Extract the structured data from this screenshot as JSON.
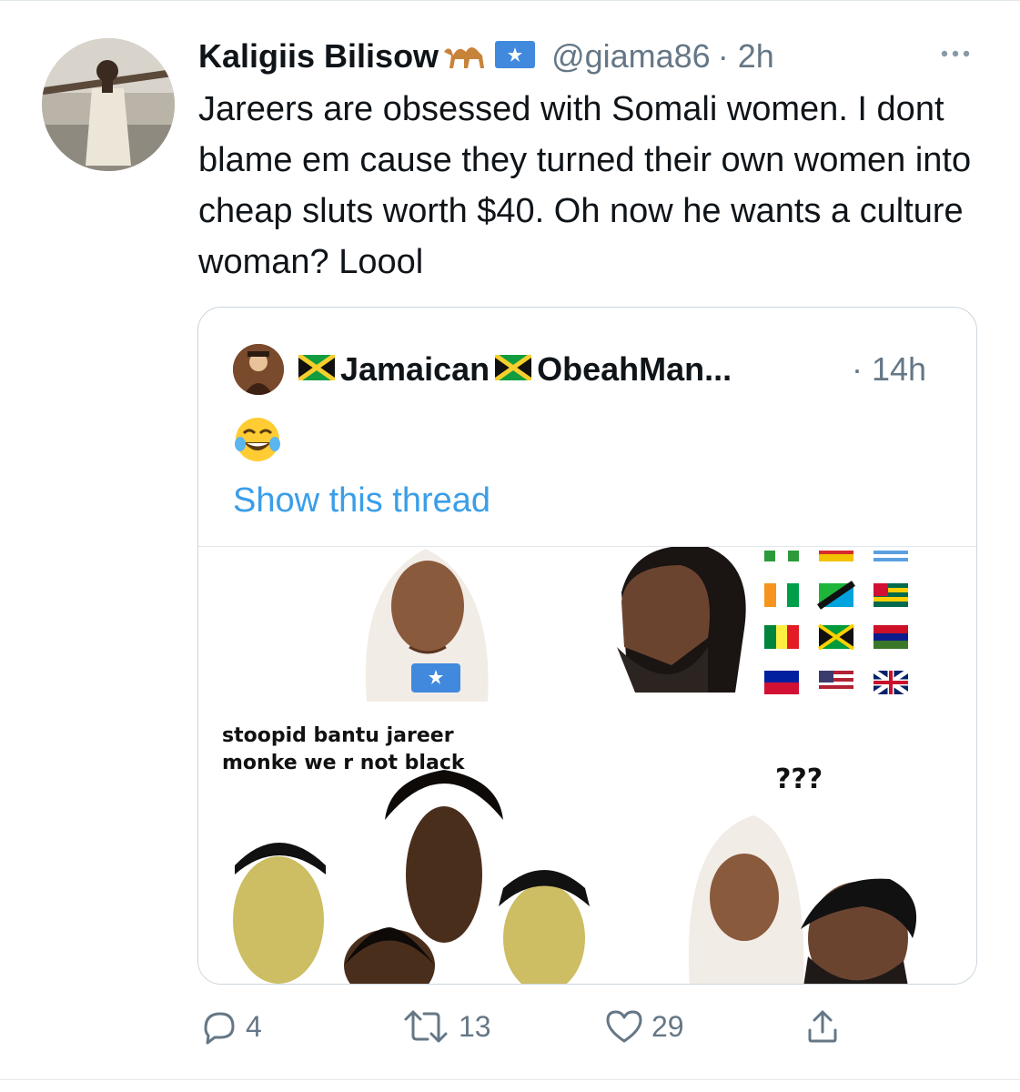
{
  "tweet": {
    "display_name": "Kaligiis Bilisow",
    "name_emojis": [
      "camel-emoji",
      "somalia-flag-emoji"
    ],
    "handle": "@giama86",
    "time": "· 2h",
    "text": "Jareers are obsessed with Somali women. I dont blame em cause they turned their own women into cheap sluts worth $40. Oh now he wants a culture woman? Loool"
  },
  "quoted_tweet": {
    "display_name": "Jamaican",
    "display_name_2": "ObeahMan...",
    "name_emojis": [
      "jamaica-flag-emoji",
      "jamaica-flag-emoji"
    ],
    "time": "· 14h",
    "text_emoji": "face-with-tears-of-joy-emoji",
    "link_text": "Show this thread",
    "image": {
      "caption_left": "stoopid bantu jareer\nmonke we r not black",
      "caption_right": "???"
    }
  },
  "actions": {
    "reply_count": "4",
    "retweet_count": "13",
    "like_count": "29"
  },
  "colors": {
    "text": "#0f1419",
    "secondary": "#657786",
    "link": "#3a9ee8",
    "border": "#ccd6dd"
  }
}
